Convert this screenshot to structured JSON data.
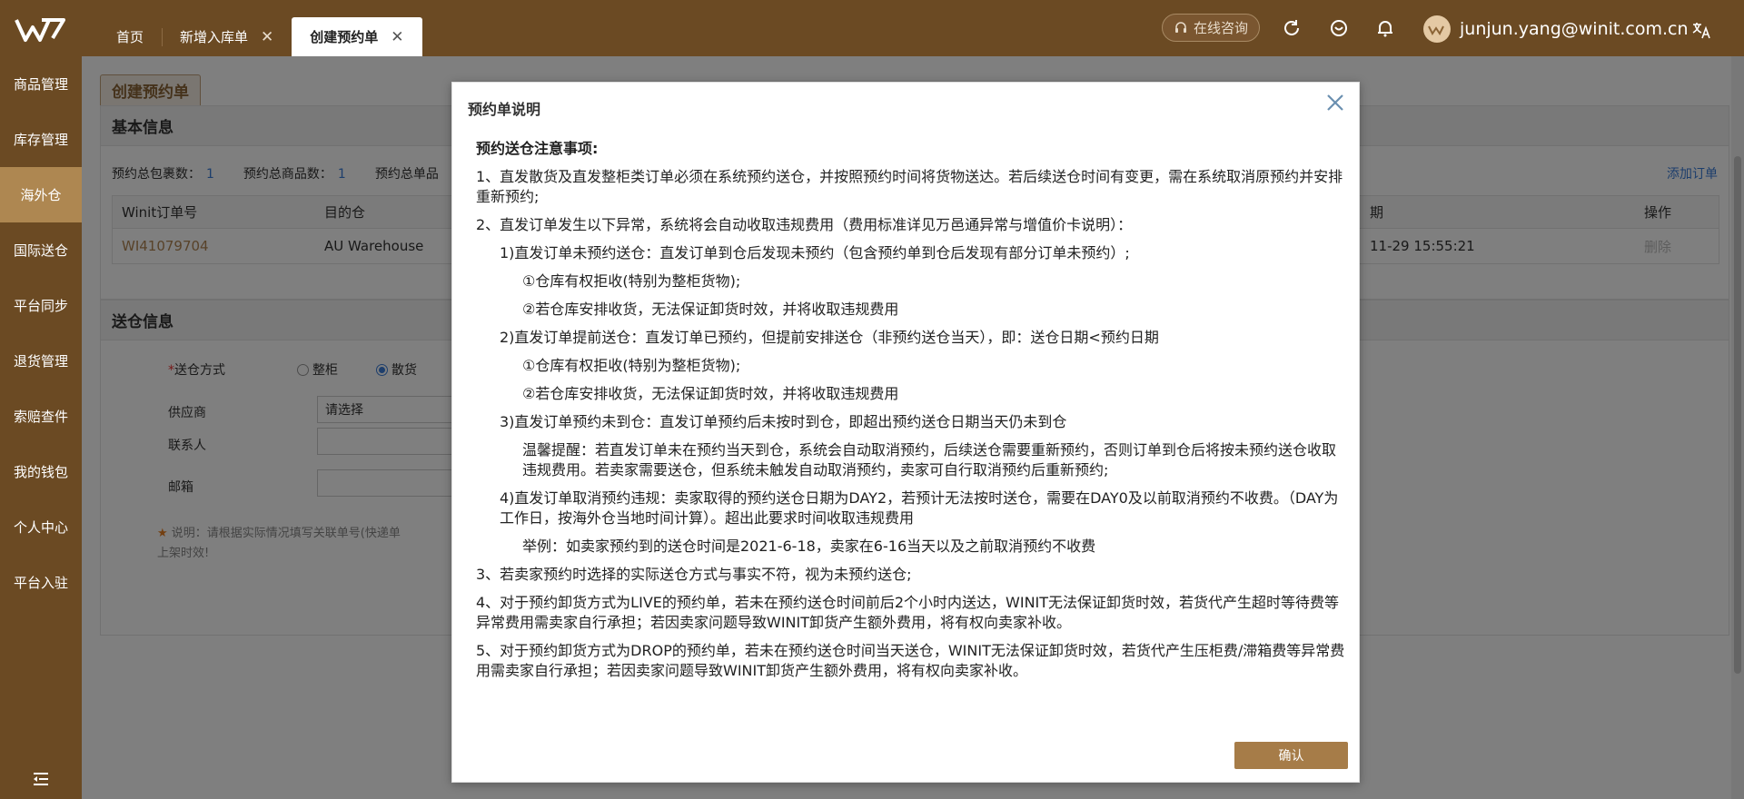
{
  "topbar": {
    "tabs": [
      {
        "label": "首页"
      },
      {
        "label": "新增入库单"
      },
      {
        "label": "创建预约单"
      }
    ],
    "consult_label": "在线咨询",
    "user_email": "junjun.yang@winit.com.cn"
  },
  "sidebar": {
    "items": [
      {
        "label": "商品管理"
      },
      {
        "label": "库存管理"
      },
      {
        "label": "海外仓"
      },
      {
        "label": "国际送仓"
      },
      {
        "label": "平台同步"
      },
      {
        "label": "退货管理"
      },
      {
        "label": "索赔查件"
      },
      {
        "label": "我的钱包"
      },
      {
        "label": "个人中心"
      },
      {
        "label": "平台入驻"
      }
    ]
  },
  "page": {
    "tab_label": "创建预约单",
    "basic_info": {
      "title": "基本信息",
      "summary": [
        {
          "label": "预约总包裹数：",
          "value": "1"
        },
        {
          "label": "预约总商品数：",
          "value": "1"
        },
        {
          "label": "预约总单品",
          "value": ""
        }
      ],
      "add_order": "添加订单",
      "columns": {
        "order_no": "Winit订单号",
        "warehouse": "目的仓",
        "date": "期",
        "action": "操作"
      },
      "row": {
        "order_no": "WI41079704",
        "warehouse": "AU Warehouse",
        "date": "11-29 15:55:21",
        "action": "删除"
      }
    },
    "delivery_info": {
      "title": "送仓信息",
      "method_label": "送仓方式",
      "method_options": [
        "整柜",
        "散货"
      ],
      "supplier_label": "供应商",
      "supplier_placeholder": "请选择",
      "contact_label": "联系人",
      "email_label": "邮箱",
      "note": "说明：请根据实际情况填写关联单号(快递单",
      "note_2": "上架时效!"
    }
  },
  "modal": {
    "title": "预约单说明",
    "heading": "预约送仓注意事项:",
    "paragraphs": [
      {
        "cls": "",
        "text": "1、直发散货及直发整柜类订单必须在系统预约送仓，并按照预约时间将货物送达。若后续送仓时间有变更，需在系统取消原预约并安排重新预约;"
      },
      {
        "cls": "",
        "text": "2、直发订单发生以下异常，系统将会自动收取违规费用（费用标准详见万邑通异常与增值价卡说明）："
      },
      {
        "cls": "i1",
        "text": "1)直发订单未预约送仓：直发订单到仓后发现未预约（包含预约单到仓后发现有部分订单未预约）;"
      },
      {
        "cls": "i2",
        "text": "①仓库有权拒收(特别为整柜货物);"
      },
      {
        "cls": "i2",
        "text": "②若仓库安排收货，无法保证卸货时效，并将收取违规费用"
      },
      {
        "cls": "i1",
        "text": "2)直发订单提前送仓：直发订单已预约，但提前安排送仓（非预约送仓当天），即：送仓日期<预约日期"
      },
      {
        "cls": "i2",
        "text": "①仓库有权拒收(特别为整柜货物);"
      },
      {
        "cls": "i2",
        "text": "②若仓库安排收货，无法保证卸货时效，并将收取违规费用"
      },
      {
        "cls": "i1",
        "text": "3)直发订单预约未到仓：直发订单预约后未按时到仓，即超出预约送仓日期当天仍未到仓"
      },
      {
        "cls": "i2",
        "text": "温馨提醒：若直发订单未在预约当天到仓，系统会自动取消预约，后续送仓需要重新预约，否则订单到仓后将按未预约送仓收取违规费用。若卖家需要送仓，但系统未触发自动取消预约，卖家可自行取消预约后重新预约;"
      },
      {
        "cls": "i1",
        "text": "4)直发订单取消预约违规：卖家取得的预约送仓日期为DAY2，若预计无法按时送仓，需要在DAY0及以前取消预约不收费。（DAY为工作日，按海外仓当地时间计算）。超出此要求时间收取违规费用"
      },
      {
        "cls": "i2",
        "text": "举例：如卖家预约到的送仓时间是2021-6-18，卖家在6-16当天以及之前取消预约不收费"
      },
      {
        "cls": "",
        "text": "3、若卖家预约时选择的实际送仓方式与事实不符，视为未预约送仓;"
      },
      {
        "cls": "",
        "text": "4、对于预约卸货方式为LIVE的预约单，若未在预约送仓时间前后2个小时内送达，WINIT无法保证卸货时效，若货代产生超时等待费等异常费用需卖家自行承担；若因卖家问题导致WINIT卸货产生额外费用，将有权向卖家补收。"
      },
      {
        "cls": "",
        "text": "5、对于预约卸货方式为DROP的预约单，若未在预约送仓时间当天送仓，WINIT无法保证卸货时效，若货代产生压柜费/滞箱费等异常费用需卖家自行承担；若因卖家问题导致WINIT卸货产生额外费用，将有权向卖家补收。"
      }
    ],
    "confirm_label": "确认"
  }
}
